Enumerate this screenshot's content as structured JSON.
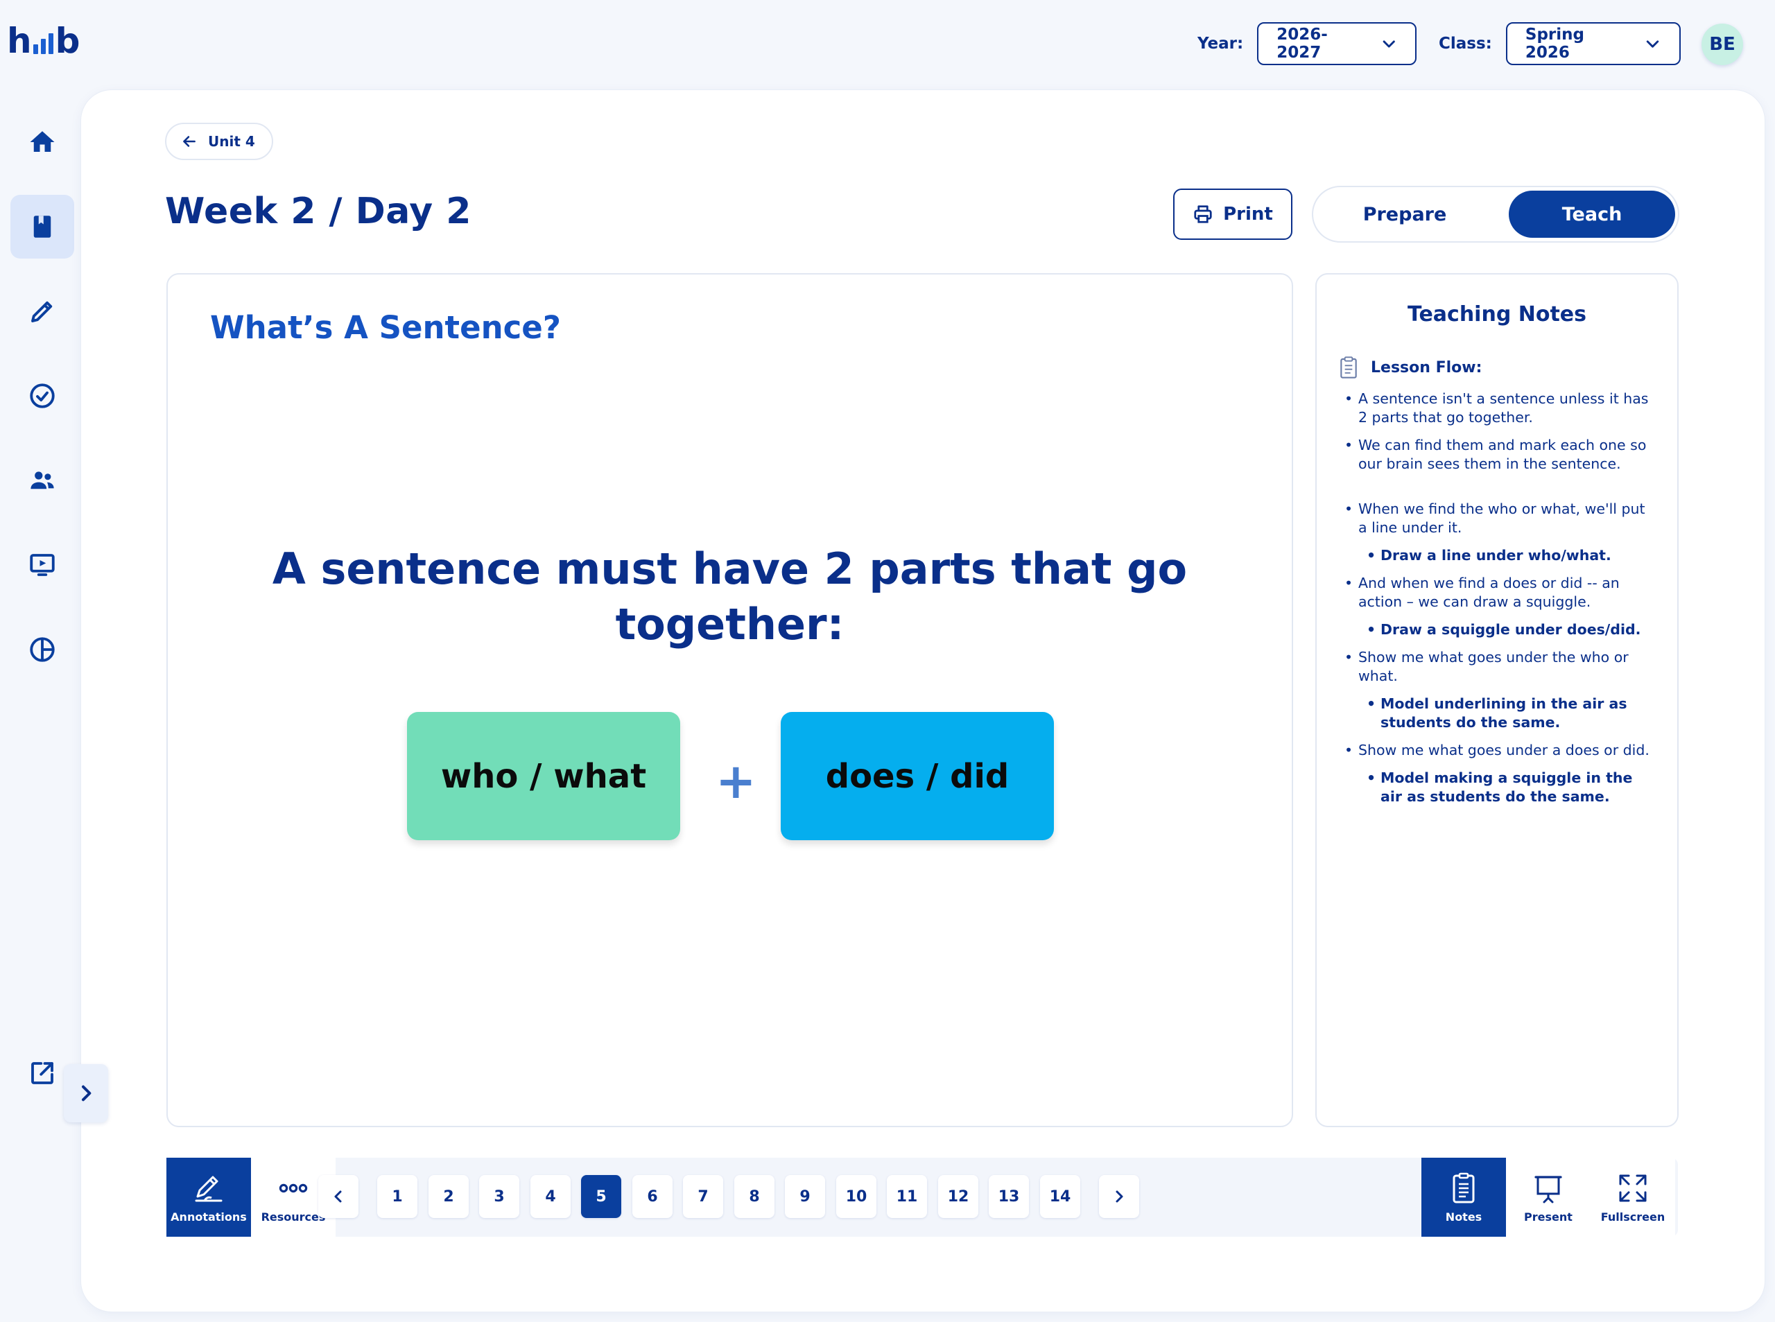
{
  "header": {
    "logo_left": "h",
    "logo_right": "b",
    "year_label": "Year:",
    "year_value": "2026-2027",
    "class_label": "Class:",
    "class_value": "Spring 2026",
    "avatar_initials": "BE"
  },
  "sidebar": {
    "items": [
      {
        "icon": "home-icon"
      },
      {
        "icon": "book-icon",
        "active": true
      },
      {
        "icon": "pencil-icon"
      },
      {
        "icon": "check-circle-icon"
      },
      {
        "icon": "people-icon"
      },
      {
        "icon": "presentation-icon"
      },
      {
        "icon": "pie-chart-icon"
      }
    ],
    "bottom_icon": "external-link-icon",
    "expand_icon": "chevron-right-icon"
  },
  "page": {
    "back_label": "Unit 4",
    "title": "Week 2 / Day 2",
    "print_label": "Print",
    "mode_prepare": "Prepare",
    "mode_teach": "Teach",
    "active_mode": "Teach"
  },
  "slide": {
    "title": "What’s A Sentence?",
    "main_line1": "A sentence must have 2 parts that go",
    "main_line2": "together:",
    "chip_left": "who / what",
    "plus": "+",
    "chip_right": "does / did",
    "chip_left_color": "#72ddb8",
    "chip_right_color": "#05aeee"
  },
  "notes": {
    "title": "Teaching Notes",
    "flow_label": "Lesson Flow:",
    "items": [
      {
        "text": "A sentence isn't a sentence unless it has 2 parts that go together.",
        "sub": false
      },
      {
        "text": "We can find them and mark each one so our brain sees them in the sentence.",
        "sub": false
      },
      {
        "text": "When we find the who or what, we'll put a line under it.",
        "sub": false,
        "gap": true
      },
      {
        "text": "Draw a line under who/what.",
        "sub": true
      },
      {
        "text": "And when we find a does or did -- an action – we can draw a squiggle.",
        "sub": false
      },
      {
        "text": "Draw a squiggle under does/did.",
        "sub": true
      },
      {
        "text": "Show me what goes under the who or what.",
        "sub": false
      },
      {
        "text": "Model underlining in the air as students do the same.",
        "sub": true
      },
      {
        "text": "Show me what goes under a does or did.",
        "sub": false
      },
      {
        "text": "Model making a squiggle in the air as students do the same.",
        "sub": true
      }
    ]
  },
  "toolbar": {
    "annotations_label": "Annotations",
    "resources_label": "Resources",
    "notes_label": "Notes",
    "present_label": "Present",
    "fullscreen_label": "Fullscreen",
    "pages": [
      "1",
      "2",
      "3",
      "4",
      "5",
      "6",
      "7",
      "8",
      "9",
      "10",
      "11",
      "12",
      "13",
      "14"
    ],
    "current_page": "5"
  },
  "colors": {
    "brand": "#0a2f8a",
    "accent": "#0a3f9e"
  }
}
